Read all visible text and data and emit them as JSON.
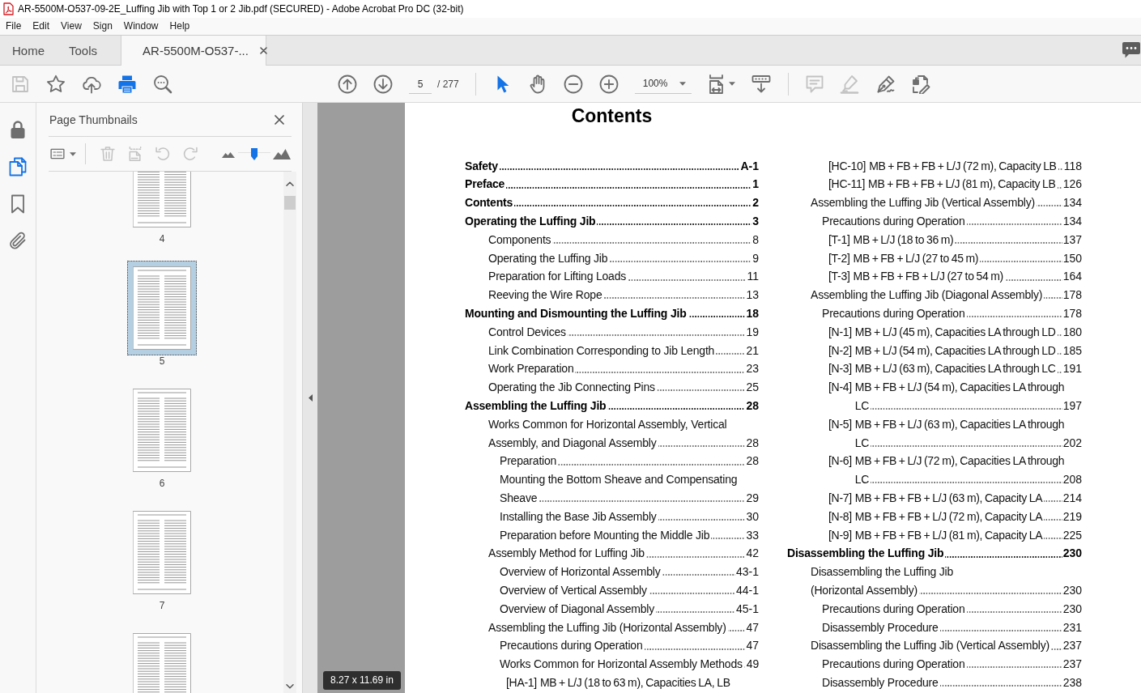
{
  "window": {
    "title": "AR-5500M-O537-09-2E_Luffing Jib with Top 1 or 2 Jib.pdf (SECURED) - Adobe Acrobat Pro DC (32-bit)"
  },
  "menu": [
    "File",
    "Edit",
    "View",
    "Sign",
    "Window",
    "Help"
  ],
  "tabs": [
    {
      "label": "Home",
      "selected": false,
      "closable": false
    },
    {
      "label": "Tools",
      "selected": false,
      "closable": false
    },
    {
      "label": "AR-5500M-O537-...",
      "selected": true,
      "closable": true
    }
  ],
  "toolbar": {
    "quick_tools": [
      {
        "kind": "save",
        "disabled": true
      },
      {
        "kind": "star",
        "disabled": false
      },
      {
        "kind": "upload",
        "disabled": false
      },
      {
        "kind": "print",
        "disabled": false
      },
      {
        "kind": "find",
        "disabled": false
      }
    ],
    "page_buttons": [
      {
        "kind": "previous"
      },
      {
        "kind": "next"
      }
    ],
    "page_field": {
      "value": "5"
    },
    "page_count": "/ 277",
    "pointer_tools": [
      {
        "kind": "select",
        "selected": true
      },
      {
        "kind": "hand",
        "selected": false
      }
    ],
    "zoom_buttons": [
      {
        "kind": "zoom-out"
      },
      {
        "kind": "zoom-in"
      }
    ],
    "zoom_field": {
      "value": "100%"
    },
    "view_tools": [
      {
        "kind": "fit-page"
      },
      {
        "kind": "scroll-mode"
      }
    ],
    "markup_tools": [
      {
        "kind": "comment",
        "disabled": true
      },
      {
        "kind": "highlight",
        "disabled": true
      },
      {
        "kind": "sign",
        "disabled": false
      },
      {
        "kind": "edit",
        "disabled": false
      }
    ]
  },
  "rail": [
    {
      "kind": "lock",
      "selected": false
    },
    {
      "kind": "pages",
      "selected": true
    },
    {
      "kind": "bookmarks",
      "selected": false
    },
    {
      "kind": "attachments",
      "selected": false
    }
  ],
  "thumbnails_panel": {
    "title": "Page Thumbnails",
    "tools": [
      {
        "kind": "options",
        "disabled": false
      },
      {
        "kind": "delete",
        "disabled": true
      },
      {
        "kind": "insert",
        "disabled": true
      },
      {
        "kind": "rotate-left",
        "disabled": true
      },
      {
        "kind": "rotate-right",
        "disabled": true
      }
    ],
    "size_slider": {
      "level": 0.5
    },
    "thumbnails": [
      {
        "page": "4",
        "selected": false
      },
      {
        "page": "5",
        "selected": true
      },
      {
        "page": "6",
        "selected": false
      },
      {
        "page": "7",
        "selected": false
      },
      {
        "selected": false
      }
    ]
  },
  "document": {
    "heading": "Contents",
    "columns": [
      {
        "entries": [
          {
            "lines": [
              "Safety"
            ],
            "page": "A-1"
          },
          {
            "lines": [
              "Preface"
            ],
            "page": "1"
          },
          {
            "lines": [
              "Contents"
            ],
            "page": "2"
          },
          {
            "lines": [
              "Operating the Luffing Jib"
            ],
            "page": "3",
            "children": [
              {
                "lines": [
                  "Components"
                ],
                "page": "8"
              },
              {
                "lines": [
                  "Operating the Luffing Jib"
                ],
                "page": "9"
              },
              {
                "lines": [
                  "Preparation for Lifting Loads"
                ],
                "page": "11"
              },
              {
                "lines": [
                  "Reeving the Wire Rope"
                ],
                "page": "13"
              }
            ]
          },
          {
            "lines": [
              "Mounting and Dismounting the Luffing Jib"
            ],
            "page": "18",
            "children": [
              {
                "lines": [
                  "Control Devices"
                ],
                "page": "19"
              },
              {
                "lines": [
                  "Link Combination Corresponding to Jib Length"
                ],
                "page": "21"
              },
              {
                "lines": [
                  "Work Preparation"
                ],
                "page": "23"
              },
              {
                "lines": [
                  "Operating the Jib Connecting Pins"
                ],
                "page": "25"
              }
            ]
          },
          {
            "lines": [
              "Assembling the Luffing Jib"
            ],
            "page": "28",
            "children": [
              {
                "lines": [
                  "Works Common for Horizontal Assembly, Vertical",
                  "Assembly, and Diagonal Assembly"
                ],
                "page": "28",
                "children": [
                  {
                    "lines": [
                      "Preparation"
                    ],
                    "page": "28"
                  },
                  {
                    "lines": [
                      "Mounting the Bottom Sheave and Compensating",
                      "Sheave"
                    ],
                    "page": "29"
                  },
                  {
                    "lines": [
                      "Installing the Base Jib Assembly"
                    ],
                    "page": "30"
                  },
                  {
                    "lines": [
                      "Preparation before Mounting the Middle Jib"
                    ],
                    "page": "33"
                  }
                ]
              },
              {
                "lines": [
                  "Assembly Method for Luffing Jib"
                ],
                "page": "42",
                "children": [
                  {
                    "lines": [
                      "Overview of Horizontal Assembly"
                    ],
                    "page": "43-1"
                  },
                  {
                    "lines": [
                      "Overview of Vertical Assembly"
                    ],
                    "page": "44-1"
                  },
                  {
                    "lines": [
                      "Overview of Diagonal Assembly"
                    ],
                    "page": "45-1"
                  }
                ]
              },
              {
                "lines": [
                  "Assembling the Luffing Jib (Horizontal Assembly)"
                ],
                "page": "47",
                "children": [
                  {
                    "lines": [
                      "Precautions during Operation"
                    ],
                    "page": "47"
                  },
                  {
                    "lines": [
                      "Works Common for Horizontal Assembly Methods"
                    ],
                    "page": "49",
                    "children": [
                      {
                        "label": "[HA-1]",
                        "lines": [
                          "MB + L/J (18 to 63 m), Capacities LA, LB"
                        ]
                      }
                    ]
                  }
                ]
              }
            ]
          }
        ]
      },
      {
        "entries": [
          {
            "children": [
              {
                "children": [
                  {
                    "children": [
                      {
                        "label": "[HC-10]",
                        "lines": [
                          "MB + FB + FB + L/J (72 m), Capacity LB"
                        ],
                        "page": "118"
                      },
                      {
                        "label": "[HC-11]",
                        "lines": [
                          "MB + FB + FB + L/J (81 m), Capacity LB"
                        ],
                        "page": "126"
                      }
                    ]
                  }
                ]
              },
              {
                "lines": [
                  "Assembling the Luffing Jib (Vertical Assembly)"
                ],
                "page": "134",
                "children": [
                  {
                    "lines": [
                      "Precautions during Operation"
                    ],
                    "page": "134",
                    "children": [
                      {
                        "label": "[T-1]",
                        "lines": [
                          "MB + L/J (18 to 36 m)"
                        ],
                        "page": "137"
                      },
                      {
                        "label": "[T-2]",
                        "lines": [
                          "MB + FB + L/J (27 to 45 m)"
                        ],
                        "page": "150"
                      },
                      {
                        "label": "[T-3]",
                        "lines": [
                          "MB + FB + FB + L/J (27 to 54 m)"
                        ],
                        "page": "164"
                      }
                    ]
                  }
                ]
              },
              {
                "lines": [
                  "Assembling the Luffing Jib (Diagonal Assembly)"
                ],
                "page": "178",
                "children": [
                  {
                    "lines": [
                      "Precautions during Operation"
                    ],
                    "page": "178",
                    "children": [
                      {
                        "label": "[N-1]",
                        "lines": [
                          "MB + L/J (45 m), Capacities LA through LD"
                        ],
                        "page": "180"
                      },
                      {
                        "label": "[N-2]",
                        "lines": [
                          "MB + L/J (54 m), Capacities LA through LD"
                        ],
                        "page": "185"
                      },
                      {
                        "label": "[N-3]",
                        "lines": [
                          "MB + L/J (63 m), Capacities LA through LC"
                        ],
                        "page": "191"
                      },
                      {
                        "label": "[N-4]",
                        "lines": [
                          "MB + FB + L/J (54 m), Capacities LA through",
                          "LC"
                        ],
                        "page": "197"
                      },
                      {
                        "label": "[N-5]",
                        "lines": [
                          "MB + FB + L/J (63 m), Capacities LA through",
                          "LC"
                        ],
                        "page": "202"
                      },
                      {
                        "label": "[N-6]",
                        "lines": [
                          "MB + FB + L/J (72 m), Capacities LA through",
                          "LC"
                        ],
                        "page": "208"
                      },
                      {
                        "label": "[N-7]",
                        "lines": [
                          "MB + FB + FB + L/J (63 m), Capacity LA"
                        ],
                        "page": "214"
                      },
                      {
                        "label": "[N-8]",
                        "lines": [
                          "MB + FB + FB + L/J (72 m), Capacity LA"
                        ],
                        "page": "219"
                      },
                      {
                        "label": "[N-9]",
                        "lines": [
                          "MB + FB + FB + L/J (81 m), Capacity LA"
                        ],
                        "page": "225"
                      }
                    ]
                  }
                ]
              }
            ]
          },
          {
            "lines": [
              "Disassembling the Luffing Jib"
            ],
            "page": "230",
            "children": [
              {
                "lines": [
                  "Disassembling the Luffing Jib",
                  "(Horizontal Assembly)"
                ],
                "page": "230",
                "children": [
                  {
                    "lines": [
                      "Precautions during Operation"
                    ],
                    "page": "230"
                  },
                  {
                    "lines": [
                      "Disassembly Procedure"
                    ],
                    "page": "231"
                  }
                ]
              },
              {
                "lines": [
                  "Disassembling the Luffing Jib (Vertical Assembly)"
                ],
                "page": "237",
                "children": [
                  {
                    "lines": [
                      "Precautions during Operation"
                    ],
                    "page": "237"
                  },
                  {
                    "lines": [
                      "Disassembly Procedure"
                    ],
                    "page": "238"
                  }
                ]
              }
            ]
          }
        ]
      }
    ]
  },
  "page_size_badge": "8.27 x 11.69 in"
}
